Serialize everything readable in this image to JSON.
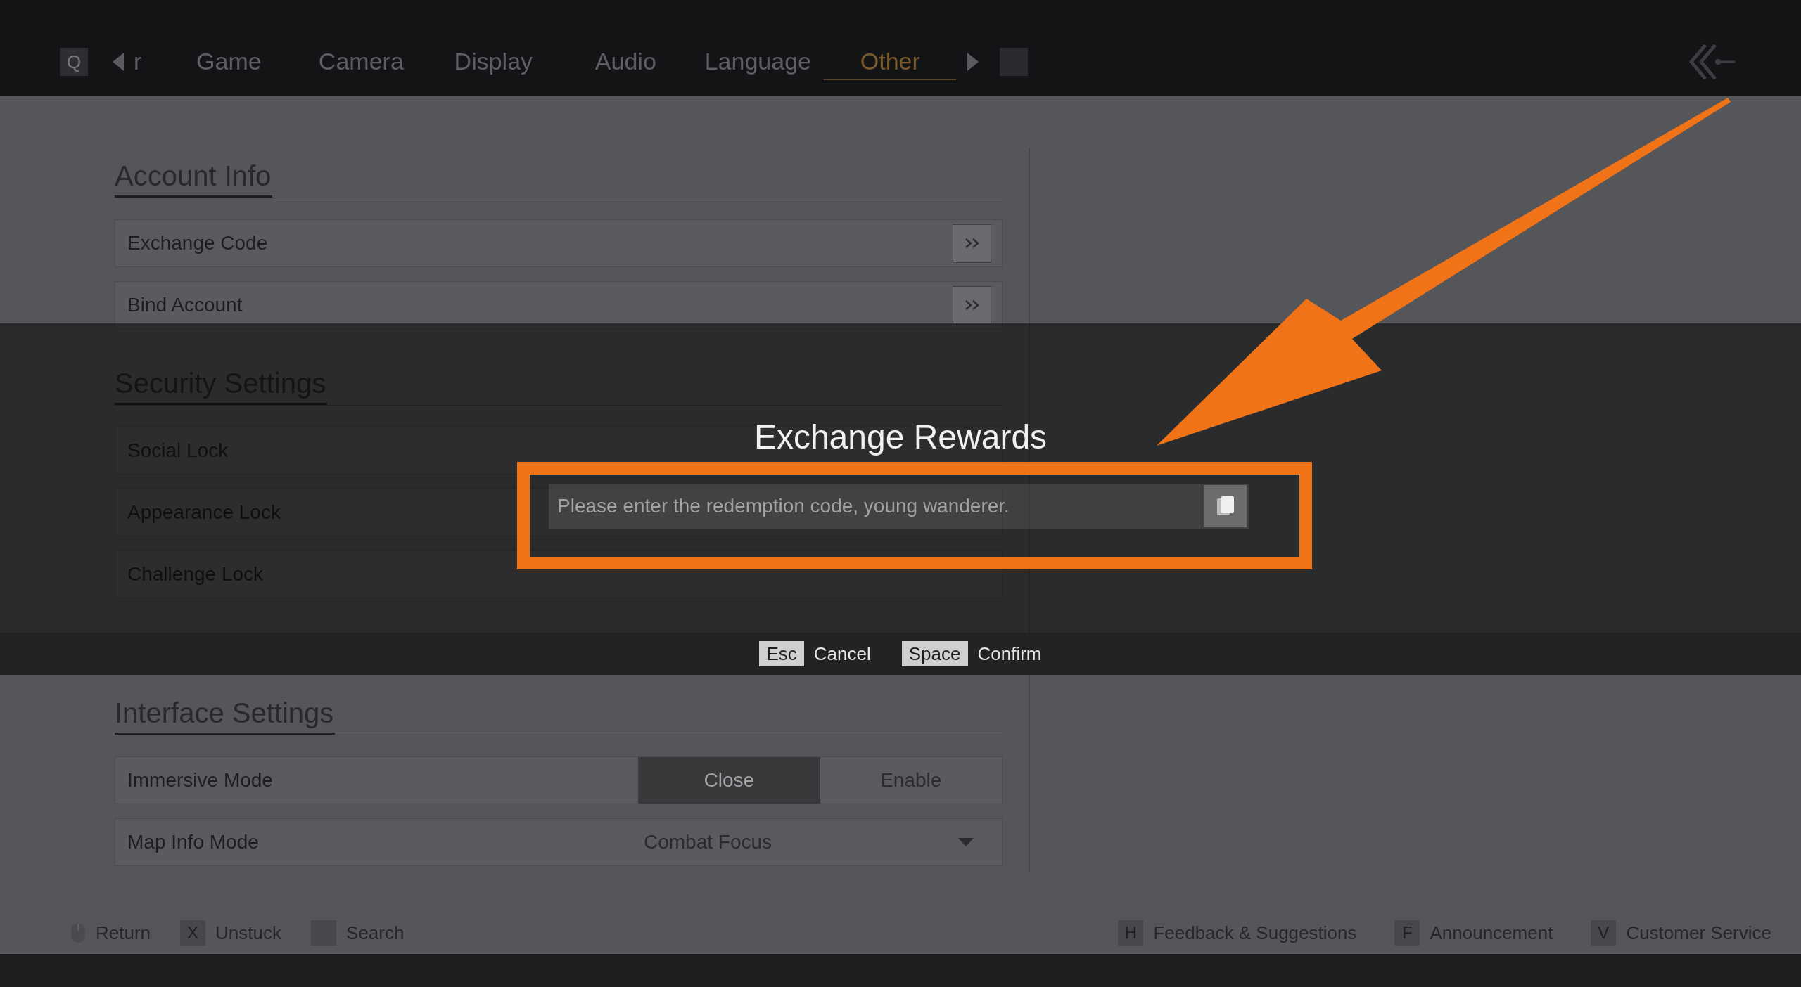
{
  "top_bar": {
    "prev_key": "Q",
    "tabs": [
      {
        "label": "r",
        "selected": false
      },
      {
        "label": "Game",
        "selected": false
      },
      {
        "label": "Camera",
        "selected": false
      },
      {
        "label": "Display",
        "selected": false
      },
      {
        "label": "Audio",
        "selected": false
      },
      {
        "label": "Language",
        "selected": false
      },
      {
        "label": "Other",
        "selected": true
      }
    ]
  },
  "sections": [
    {
      "title": "Account Info",
      "rows": [
        {
          "kind": "link",
          "label": "Exchange Code"
        },
        {
          "kind": "link",
          "label": "Bind Account"
        }
      ]
    },
    {
      "title": "Security Settings",
      "rows": [
        {
          "kind": "plain",
          "label": "Social Lock"
        },
        {
          "kind": "plain",
          "label": "Appearance Lock"
        },
        {
          "kind": "plain",
          "label": "Challenge Lock"
        }
      ]
    },
    {
      "title": "Interface Settings",
      "rows": [
        {
          "kind": "toggle",
          "label": "Immersive Mode",
          "options": [
            {
              "label": "Close",
              "selected": true
            },
            {
              "label": "Enable",
              "selected": false
            }
          ]
        },
        {
          "kind": "dropdown",
          "label": "Map Info Mode",
          "value": "Combat Focus"
        }
      ]
    }
  ],
  "dialog": {
    "title": "Exchange Rewards",
    "input": {
      "placeholder": "Please enter the redemption code, young wanderer."
    },
    "actions": [
      {
        "key": "Esc",
        "label": "Cancel"
      },
      {
        "key": "Space",
        "label": "Confirm"
      }
    ]
  },
  "bottom_hints": {
    "left": [
      {
        "kind": "mouse",
        "label": "Return"
      },
      {
        "kind": "key",
        "key": "X",
        "label": "Unstuck"
      },
      {
        "kind": "key",
        "label": "Search"
      }
    ],
    "right": [
      {
        "kind": "key",
        "key": "H",
        "label": "Feedback & Suggestions"
      },
      {
        "kind": "key",
        "key": "F",
        "label": "Announcement"
      },
      {
        "kind": "key",
        "key": "V",
        "label": "Customer Service"
      }
    ]
  }
}
